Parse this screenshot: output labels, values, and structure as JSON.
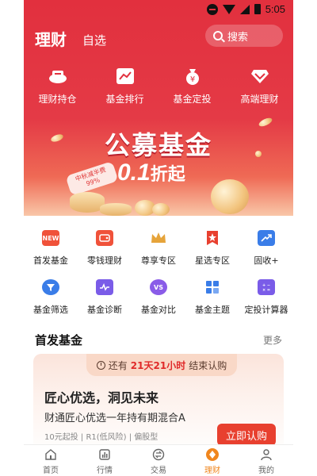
{
  "status": {
    "time": "5:05"
  },
  "header": {
    "title": "理财",
    "subtitle": "自选",
    "search_label": "搜索"
  },
  "top_nav": [
    {
      "label": "理财持仓",
      "icon": "wallet-icon"
    },
    {
      "label": "基金排行",
      "icon": "trend-chart-icon"
    },
    {
      "label": "基金定投",
      "icon": "money-bag-icon"
    },
    {
      "label": "高端理财",
      "icon": "diamond-icon"
    }
  ],
  "banner": {
    "title": "公募基金",
    "discount_number": "0.1",
    "discount_text": "折起",
    "tag_line1": "中秋减半费",
    "tag_line2": "99%"
  },
  "grid": {
    "row1": [
      {
        "label": "首发基金",
        "icon": "new-badge-icon",
        "badge": "NEW",
        "color": "#f0523a"
      },
      {
        "label": "零钱理财",
        "icon": "coin-purse-icon",
        "color": "#f0523a"
      },
      {
        "label": "尊享专区",
        "icon": "crown-icon",
        "color": "#e6a43a"
      },
      {
        "label": "星选专区",
        "icon": "star-bookmark-icon",
        "color": "#e8402f"
      },
      {
        "label": "固收+",
        "icon": "growth-arrow-icon",
        "color": "#3a7de8"
      }
    ],
    "row2": [
      {
        "label": "基金筛选",
        "icon": "filter-icon",
        "color": "#3a7de8"
      },
      {
        "label": "基金诊断",
        "icon": "pulse-icon",
        "color": "#7a5ce8"
      },
      {
        "label": "基金对比",
        "icon": "versus-icon",
        "badge": "VS",
        "color": "#8a5ce8"
      },
      {
        "label": "基金主题",
        "icon": "grid-tiles-icon",
        "color": "#3a7de8"
      },
      {
        "label": "定投计算器",
        "icon": "calculator-icon",
        "color": "#7a5ce8"
      }
    ]
  },
  "section": {
    "title": "首发基金",
    "more": "更多"
  },
  "card": {
    "countdown_prefix": "还有",
    "countdown_value": "21天21小时",
    "countdown_suffix": "结束认购",
    "headline": "匠心优选，洞见未来",
    "fund_name": "财通匠心优选一年持有期混合A",
    "meta": "10元起投 | R1(低风险) | 偏股型",
    "button": "立即认购"
  },
  "tabbar": [
    {
      "label": "首页",
      "icon": "home-icon",
      "active": false
    },
    {
      "label": "行情",
      "icon": "market-chart-icon",
      "active": false
    },
    {
      "label": "交易",
      "icon": "exchange-icon",
      "active": false
    },
    {
      "label": "理财",
      "icon": "finance-icon",
      "active": true
    },
    {
      "label": "我的",
      "icon": "profile-icon",
      "active": false
    }
  ],
  "colors": {
    "brand_red": "#e2303e",
    "active_tab": "#f0861d",
    "button_red": "#e8402f"
  }
}
